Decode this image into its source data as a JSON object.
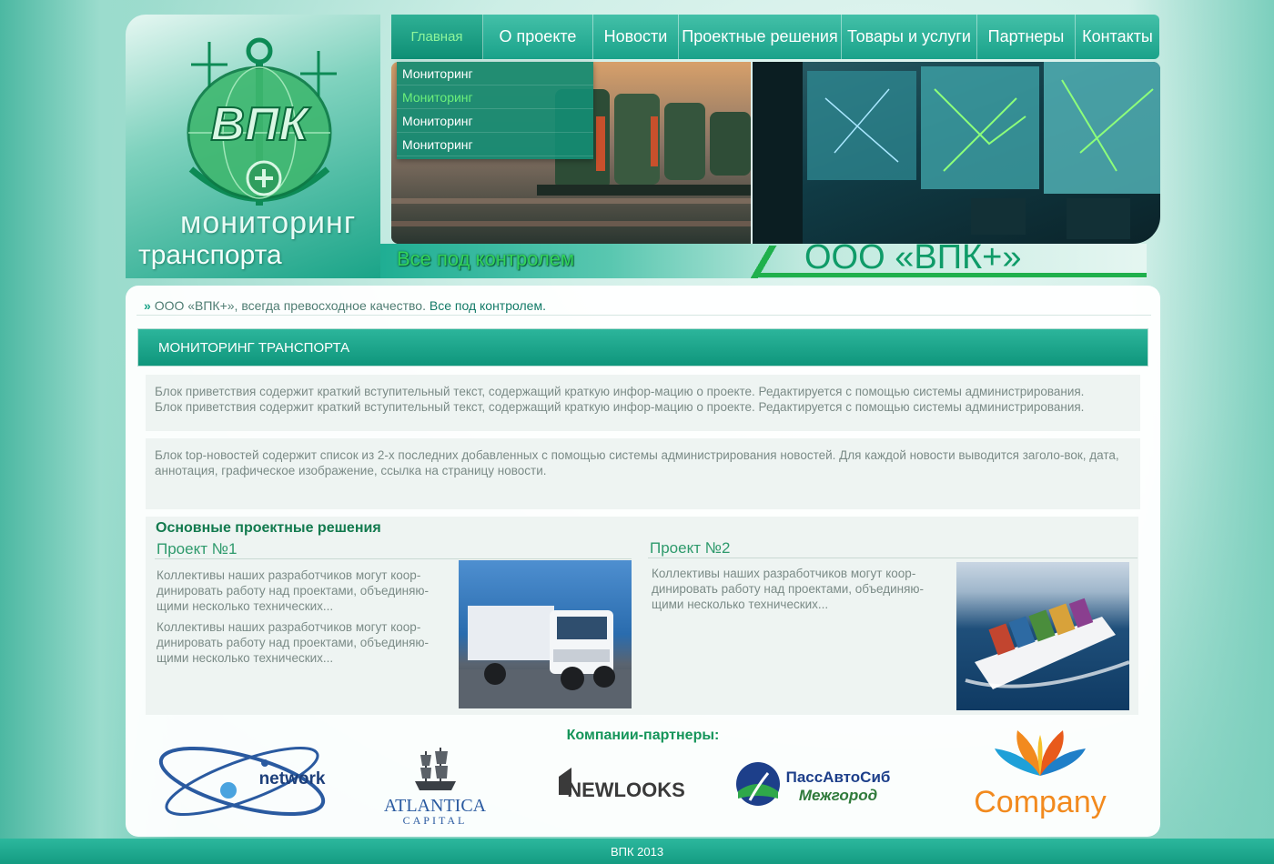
{
  "logo": {
    "emblem_text": "ВПК",
    "word1": "мониторинг",
    "word2": "транспорта"
  },
  "nav": {
    "items": [
      {
        "label": "Главная",
        "width": 101
      },
      {
        "label": "О проекте",
        "width": 121
      },
      {
        "label": "Новости",
        "width": 94
      },
      {
        "label": "Проектные решения",
        "width": 179
      },
      {
        "label": "Товары и услуги",
        "width": 149
      },
      {
        "label": "Партнеры",
        "width": 108
      },
      {
        "label": "Контакты",
        "width": 92
      }
    ],
    "dropdown": [
      "Мониторинг",
      "Мониторинг",
      "Мониторинг",
      "Мониторинг"
    ]
  },
  "header": {
    "slogan": "Все под контролем",
    "company": "ООО «ВПК+»"
  },
  "breadcrumb": {
    "arrow": "»",
    "text": "ООО «ВПК+», всегда превосходное качество.",
    "link": "Все под контролем."
  },
  "section": {
    "title": "МОНИТОРИНГ ТРАНСПОРТА"
  },
  "welcome": {
    "line1": "Блок приветствия содержит краткий вступительный текст, содержащий краткую инфор-мацию о проекте. Редактируется с помощью системы администрирования.",
    "line2": "Блок приветствия содержит краткий вступительный текст, содержащий краткую инфор-мацию о проекте. Редактируется с помощью системы администрирования."
  },
  "topnews": {
    "text": "Блок top-новостей содержит список из 2-х последних добавленных с помощью системы администрирования новостей. Для каждой новости  выводится заголо-вок, дата, аннотация, графическое изображение, ссылка на страницу новости."
  },
  "projects": {
    "title": "Основные проектные решения",
    "p1": {
      "name": "Проект №1",
      "text1": "Коллективы наших разработчиков могут коор-динировать работу над проектами, объединяю-щими несколько технических...",
      "text2": "Коллективы наших разработчиков могут коор-динировать работу над проектами, объединяю-щими несколько технических..."
    },
    "p2": {
      "name": "Проект №2",
      "text1": "Коллективы наших разработчиков могут коор-динировать работу над проектами, объединяю-щими несколько технических..."
    }
  },
  "partners": {
    "title": "Компании-партнеры:",
    "network": "network",
    "atlantica1": "ATLANTICA",
    "atlantica2": "CAPITAL",
    "newlooks": "NEWLOOKS",
    "pass1": "ПассАвтоСиб",
    "pass2": "Межгород",
    "company": "Company"
  },
  "footer": {
    "text": "ВПК  2013"
  }
}
